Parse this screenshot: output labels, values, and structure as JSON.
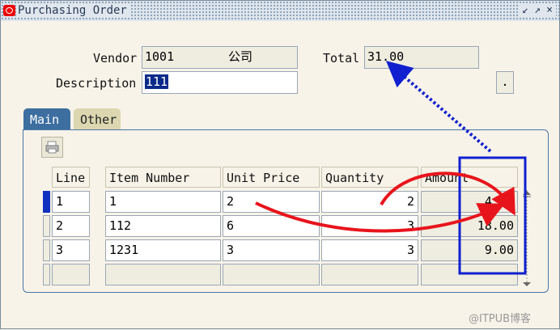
{
  "window": {
    "title": "Purchasing Order",
    "buttons": {
      "minimize": "↙",
      "maximize": "↗",
      "close": "×"
    }
  },
  "header": {
    "vendor_label": "Vendor",
    "vendor_id": "1001",
    "vendor_name": "公司",
    "total_label": "Total",
    "total_value": "31.00",
    "description_label": "Description",
    "description_value": "111",
    "extra_button": "."
  },
  "tabs": [
    {
      "label": "Main",
      "active": true
    },
    {
      "label": "Other",
      "active": false
    }
  ],
  "table": {
    "columns": [
      "Line",
      "Item Number",
      "Unit Price",
      "Quantity",
      "Amount"
    ],
    "rows": [
      {
        "line": "1",
        "item": "1",
        "price": "2",
        "quantity": "2",
        "amount": "4.00"
      },
      {
        "line": "2",
        "item": "112",
        "price": "6",
        "quantity": "3",
        "amount": "18.00"
      },
      {
        "line": "3",
        "item": "1231",
        "price": "3",
        "quantity": "3",
        "amount": "9.00"
      }
    ]
  },
  "colors": {
    "tab_active": "#3d6ea0",
    "tab_inactive": "#dcd7b0",
    "annotation_red": "#e8141c",
    "annotation_blue": "#1020d0",
    "selection": "#0a2a8a"
  },
  "watermark": "@ITPUB博客"
}
